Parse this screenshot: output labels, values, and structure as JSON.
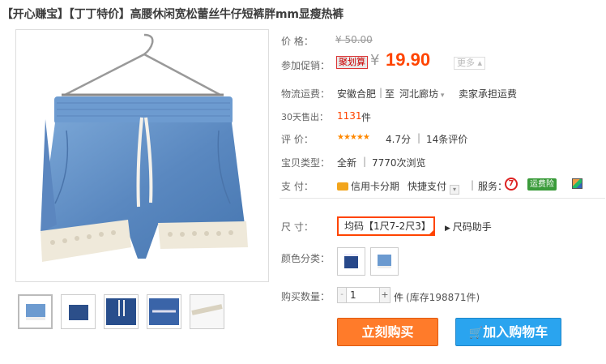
{
  "title": "【开心赚宝】【丁丁特价】高腰休闲宽松蕾丝牛仔短裤胖mm显瘦热裤",
  "price_row": {
    "label": "价    格：",
    "original": "¥ 50.00"
  },
  "promo_row": {
    "label": "参加促销：",
    "tag": "聚划算",
    "currency": "¥",
    "price": "19.90",
    "more": "更多 ▴"
  },
  "shipping_row": {
    "label": "物流运费：",
    "from": "安徽合肥",
    "sep": "|",
    "to_prefix": "至",
    "to": "河北廊坊",
    "fee": "卖家承担运费"
  },
  "sales_row": {
    "label_num": "30",
    "label": "天售出：",
    "count": "1131",
    "unit": "件"
  },
  "rating_row": {
    "label": "评    价：",
    "stars": "★★★★★",
    "score": "4.7分",
    "sep": "|",
    "reviews": "14条评价"
  },
  "type_row": {
    "label": "宝贝类型：",
    "type": "全新",
    "sep": "|",
    "views": "7770次浏览"
  },
  "payment_row": {
    "label": "支    付：",
    "credit": "信用卡分期",
    "quick": "快捷支付",
    "service_label": "服务：",
    "seven_icon": "7",
    "freight": "运费险"
  },
  "size_row": {
    "label": "尺    寸：",
    "selected": "均码【1尺7-2尺3】",
    "helper": "尺码助手"
  },
  "color_row": {
    "label": "颜色分类："
  },
  "qty_row": {
    "label": "购买数量：",
    "minus": "-",
    "value": "1",
    "plus": "+",
    "unit": "件",
    "stock": "(库存198871件)"
  },
  "buttons": {
    "buy": "立刻购买",
    "cart": "加入购物车"
  },
  "colors": {
    "price": "#ff4400",
    "buy_button": "#ff7b2a",
    "cart_button": "#2aa4ef",
    "denim": "#5b8bc4"
  }
}
